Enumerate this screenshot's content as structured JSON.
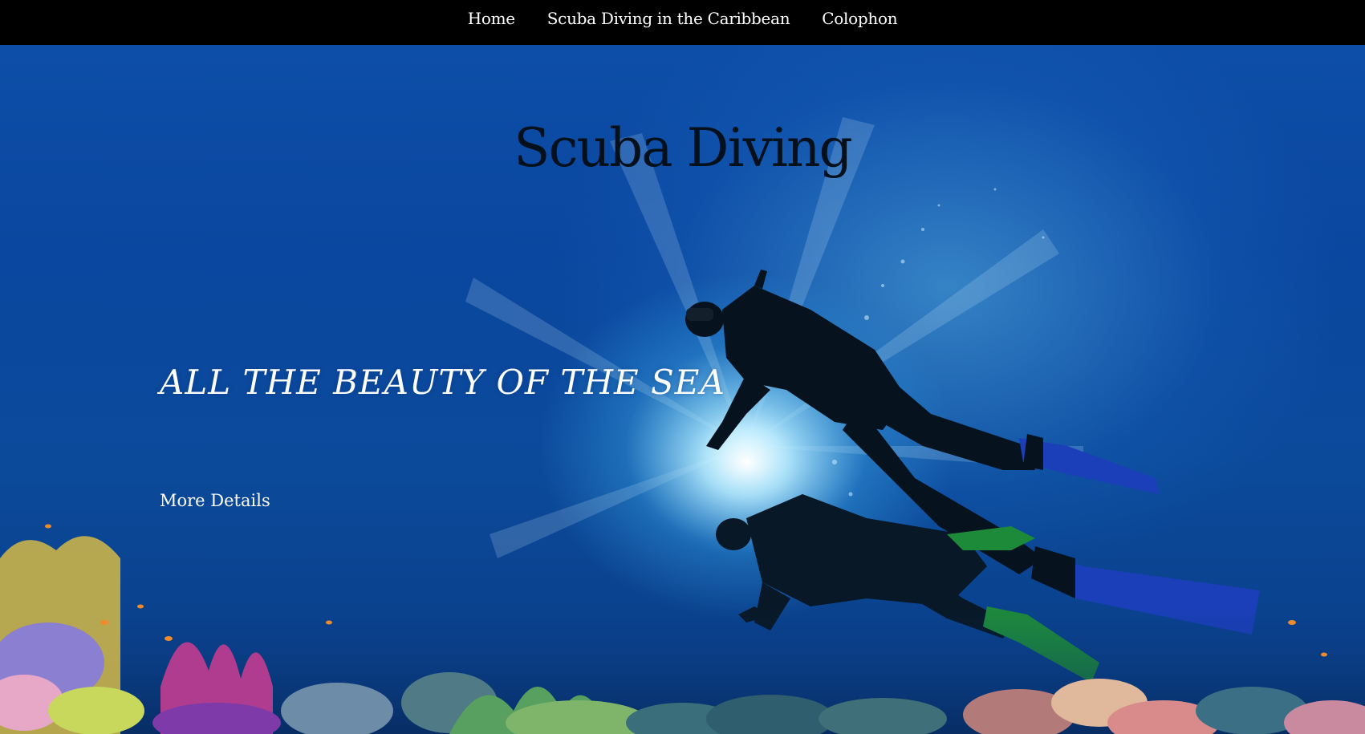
{
  "nav": {
    "items": [
      {
        "label": "Home"
      },
      {
        "label": "Scuba Diving in the Caribbean"
      },
      {
        "label": "Colophon"
      }
    ]
  },
  "hero": {
    "title": "Scuba Diving",
    "tagline": "ALL THE BEAUTY OF THE SEA",
    "cta_label": "More Details"
  },
  "colors": {
    "nav_background": "#000000",
    "water": "#0b4a9b",
    "title_text": "#04101c",
    "hero_text": "#ffffff"
  },
  "images": {
    "background": "underwater-divers-coral-reef-photo"
  }
}
